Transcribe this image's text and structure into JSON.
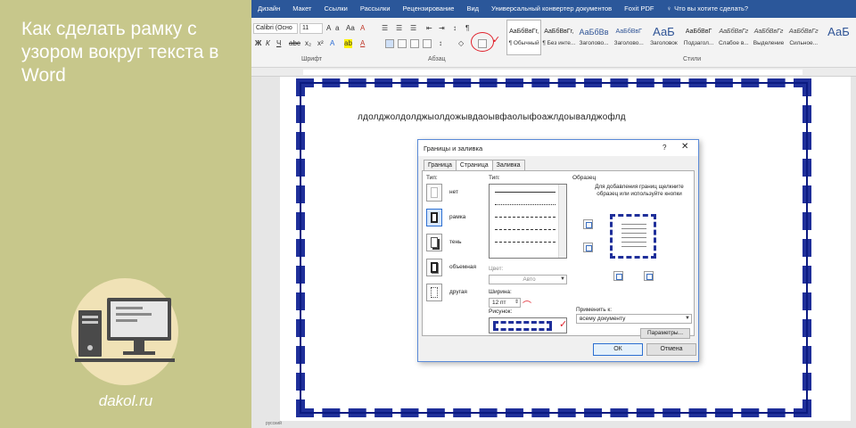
{
  "article": {
    "title": "Как сделать рамку с узором вокруг текста в Word",
    "site": "dakol.ru"
  },
  "word": {
    "ribbon_tabs": [
      "Дизайн",
      "Макет",
      "Ссылки",
      "Рассылки",
      "Рецензирование",
      "Вид",
      "Универсальный конвертер документов",
      "Foxit PDF"
    ],
    "search_placeholder": "Что вы хотите сделать?",
    "font_name": "Calibri (Осно",
    "font_size": "11",
    "group_font": "Шрифт",
    "group_paragraph": "Абзац",
    "group_styles": "Стили",
    "styles": [
      {
        "sample": "АаБбВвГг,",
        "name": "¶ Обычный"
      },
      {
        "sample": "АаБбВвГг,",
        "name": "¶ Без инте..."
      },
      {
        "sample": "АаБбВв",
        "name": "Заголово..."
      },
      {
        "sample": "АаБбВвГ",
        "name": "Заголово..."
      },
      {
        "sample": "АаБ",
        "name": "Заголовок"
      },
      {
        "sample": "АаБбВвГ",
        "name": "Подзагол..."
      },
      {
        "sample": "АаБбВвГг",
        "name": "Слабое в..."
      },
      {
        "sample": "АаБбВвГг",
        "name": "Выделение"
      },
      {
        "sample": "АаБбВвГг",
        "name": "Сильное..."
      },
      {
        "sample": "АаБ",
        "name": ""
      }
    ],
    "document_text": "лдолджолдолджыолдожывдаоывфаолыфоажлдоывалджофлд",
    "status_text": "русский"
  },
  "dialog": {
    "title": "Границы и заливка",
    "help": "?",
    "close": "✕",
    "tabs": [
      "Граница",
      "Страница",
      "Заливка"
    ],
    "active_tab": "Страница",
    "setting_label": "Тип:",
    "settings": [
      "нет",
      "рамка",
      "тень",
      "объемная",
      "другая"
    ],
    "type_label": "Тип:",
    "color_label": "Цвет:",
    "color_value": "Авто",
    "width_label": "Ширина:",
    "width_value": "12 пт",
    "art_label": "Рисунок:",
    "preview_label": "Образец",
    "preview_desc": "Для добавления границ щелкните образец или используйте кнопки",
    "apply_label": "Применить к:",
    "apply_value": "всему документу",
    "params_button": "Параметры...",
    "ok": "ОК",
    "cancel": "Отмена"
  },
  "colors": {
    "panel_green": "#c7c78b",
    "ribbon_blue": "#2b579a",
    "border_art_blue": "#1f2f9a",
    "annotation_red": "#e0202a"
  }
}
